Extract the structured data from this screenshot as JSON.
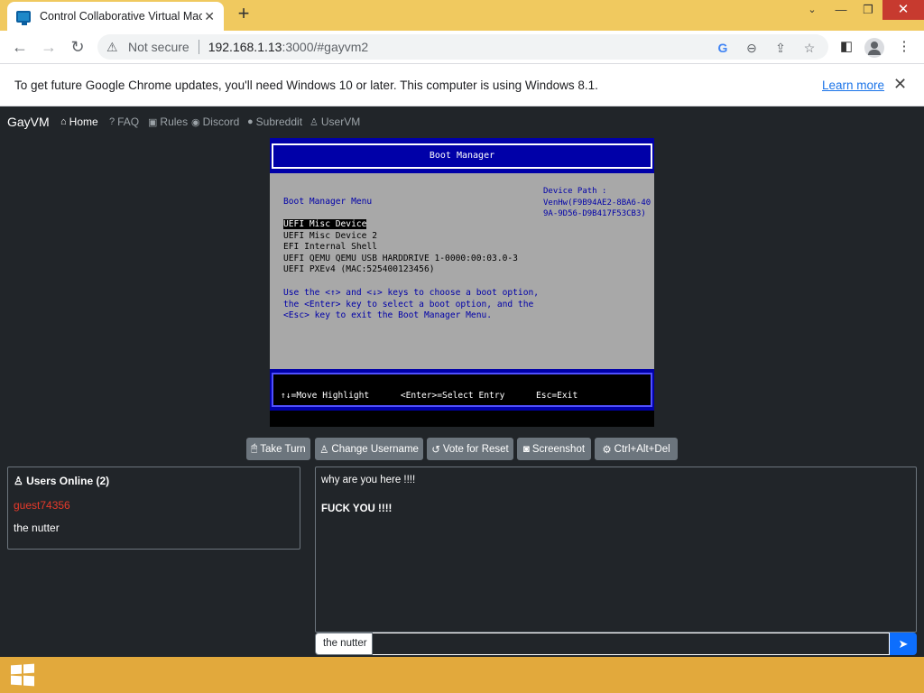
{
  "browser": {
    "tab_title": "Control Collaborative Virtual Mac",
    "tab_close": "✕",
    "new_tab": "+",
    "security_label": "Not secure",
    "url_host": "192.168.1.13",
    "url_rest": ":3000/#gayvm2",
    "infobar_message": "To get future Google Chrome updates, you'll need Windows 10 or later. This computer is using Windows 8.1.",
    "infobar_link": "Learn more"
  },
  "site_nav": {
    "brand": "GayVM",
    "links": [
      {
        "label": "Home",
        "icon": "home-icon",
        "glyph": "⌂"
      },
      {
        "label": "FAQ",
        "icon": "question-icon",
        "glyph": "?"
      },
      {
        "label": "Rules",
        "icon": "clipboard-icon",
        "glyph": "▣"
      },
      {
        "label": "Discord",
        "icon": "discord-icon",
        "glyph": "◉"
      },
      {
        "label": "Subreddit",
        "icon": "reddit-icon",
        "glyph": "●"
      },
      {
        "label": "UserVM",
        "icon": "user-icon",
        "glyph": "♙"
      }
    ]
  },
  "vm_screen": {
    "header": "Boot Manager",
    "menu_title": "Boot Manager Menu",
    "device_path": "Device Path :\nVenHw(F9B94AE2-8BA6-40\n9A-9D56-D9B417F53CB3)",
    "options": [
      "UEFI Misc Device",
      "UEFI Misc Device 2",
      "EFI Internal Shell",
      "UEFI QEMU QEMU USB HARDDRIVE 1-0000:00:03.0-3",
      "UEFI PXEv4 (MAC:525400123456)"
    ],
    "help_text": "Use the <↑> and <↓> keys to choose a boot option,\nthe <Enter> key to select a boot option, and the\n<Esc> key to exit the Boot Manager Menu.",
    "footer": "↑↓=Move Highlight      <Enter>=Select Entry      Esc=Exit"
  },
  "buttons": {
    "take_turn": "Take Turn",
    "change_username": "Change Username",
    "vote_reset": "Vote for Reset",
    "screenshot": "Screenshot",
    "ctrl_alt_del": "Ctrl+Alt+Del"
  },
  "users": {
    "title": "Users Online (2)",
    "list": [
      "guest74356",
      "the nutter"
    ]
  },
  "chat": {
    "messages": [
      "why are you here !!!!",
      "FUCK YOU !!!!"
    ],
    "username": "the nutter",
    "input_value": ""
  },
  "colors": {
    "titlebar": "#f0c95f",
    "page_bg": "#212529",
    "vm_blue": "#0000a8",
    "button": "#6c757d",
    "send": "#0d6efd",
    "guest_user": "#e83a2a",
    "taskbar": "#e2a93c"
  }
}
